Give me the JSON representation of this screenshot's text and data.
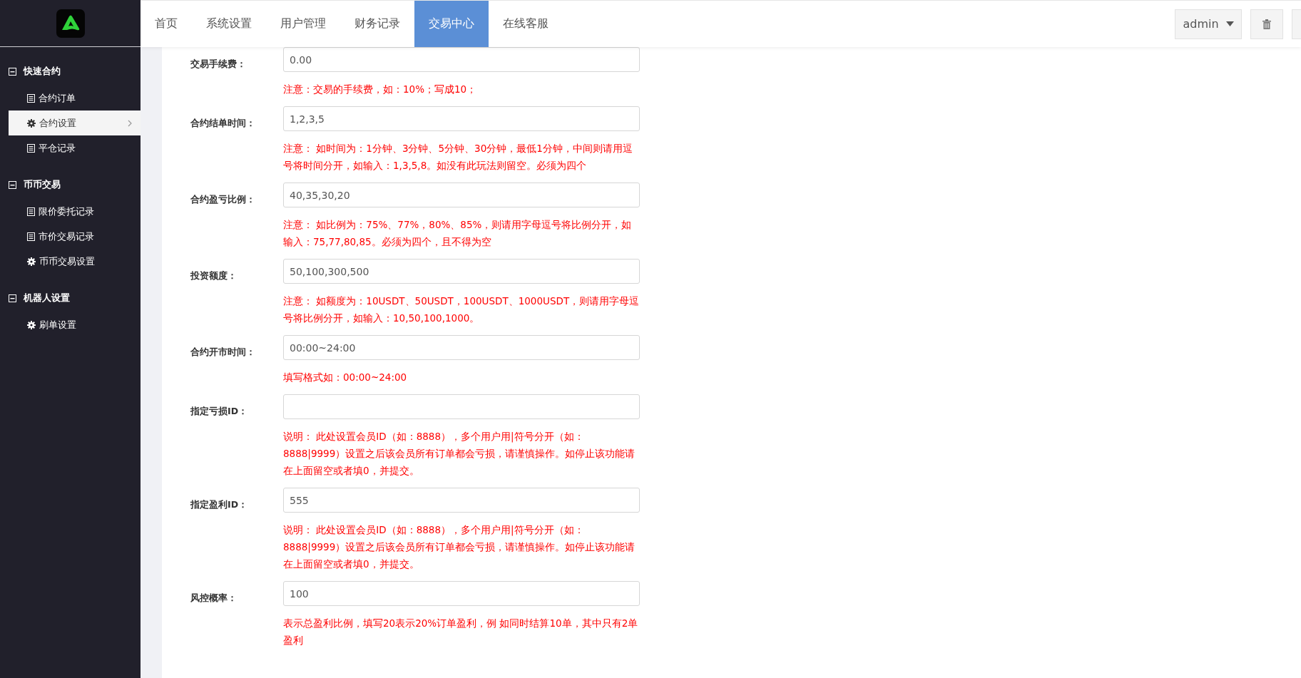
{
  "nav": [
    {
      "label": "首页",
      "selected": false
    },
    {
      "label": "系统设置",
      "selected": false
    },
    {
      "label": "用户管理",
      "selected": false
    },
    {
      "label": "财务记录",
      "selected": false
    },
    {
      "label": "交易中心",
      "selected": true
    },
    {
      "label": "在线客服",
      "selected": false
    }
  ],
  "user_menu": {
    "label": "admin"
  },
  "sidebar": [
    {
      "title": "快速合约",
      "expanded": true,
      "items": [
        {
          "label": "合约订单",
          "kind": "list",
          "selected": false
        },
        {
          "label": "合约设置",
          "kind": "settings",
          "selected": true
        },
        {
          "label": "平仓记录",
          "kind": "list",
          "selected": false
        }
      ]
    },
    {
      "title": "币币交易",
      "expanded": true,
      "items": [
        {
          "label": "限价委托记录",
          "kind": "list",
          "selected": false
        },
        {
          "label": "市价交易记录",
          "kind": "list",
          "selected": false
        },
        {
          "label": "币币交易设置",
          "kind": "settings",
          "selected": false
        }
      ]
    },
    {
      "title": "机器人设置",
      "expanded": true,
      "items": [
        {
          "label": "刷单设置",
          "kind": "settings",
          "selected": false
        }
      ]
    }
  ],
  "form": [
    {
      "label": "交易手续费：",
      "value": "0.00",
      "note": "注意：交易的手续费，如：10%；写成10；"
    },
    {
      "label": "合约结单时间：",
      "value": "1,2,3,5",
      "note": "注意： 如时间为：1分钟、3分钟、5分钟、30分钟，最低1分钟，中间则请用逗号将时间分开，如输入：1,3,5,8。如没有此玩法则留空。必须为四个"
    },
    {
      "label": "合约盈亏比例：",
      "value": "40,35,30,20",
      "note": "注意： 如比例为：75%、77%，80%、85%，则请用字母逗号将比例分开，如输入：75,77,80,85。必须为四个，且不得为空"
    },
    {
      "label": "投资额度：",
      "value": "50,100,300,500",
      "note": "注意： 如额度为：10USDT、50USDT，100USDT、1000USDT，则请用字母逗号将比例分开，如输入：10,50,100,1000。"
    },
    {
      "label": "合约开市时间：",
      "value": "00:00~24:00",
      "note": "填写格式如：00:00~24:00"
    },
    {
      "label": "指定亏损ID：",
      "note": "说明： 此处设置会员ID（如：8888），多个用户用|符号分开（如：8888|9999）设置之后该会员所有订单都会亏损，请谨慎操作。如停止该功能请在上面留空或者填0，并提交。"
    },
    {
      "label": "指定盈利ID：",
      "value": "555",
      "note": "说明： 此处设置会员ID（如：8888），多个用户用|符号分开（如：8888|9999）设置之后该会员所有订单都会亏损，请谨慎操作。如停止该功能请在上面留空或者填0，并提交。"
    },
    {
      "label": "风控概率：",
      "value": "100",
      "note": "表示总盈利比例，填写20表示20%订单盈利，例 如同时结算10单，其中只有2单盈利"
    }
  ]
}
